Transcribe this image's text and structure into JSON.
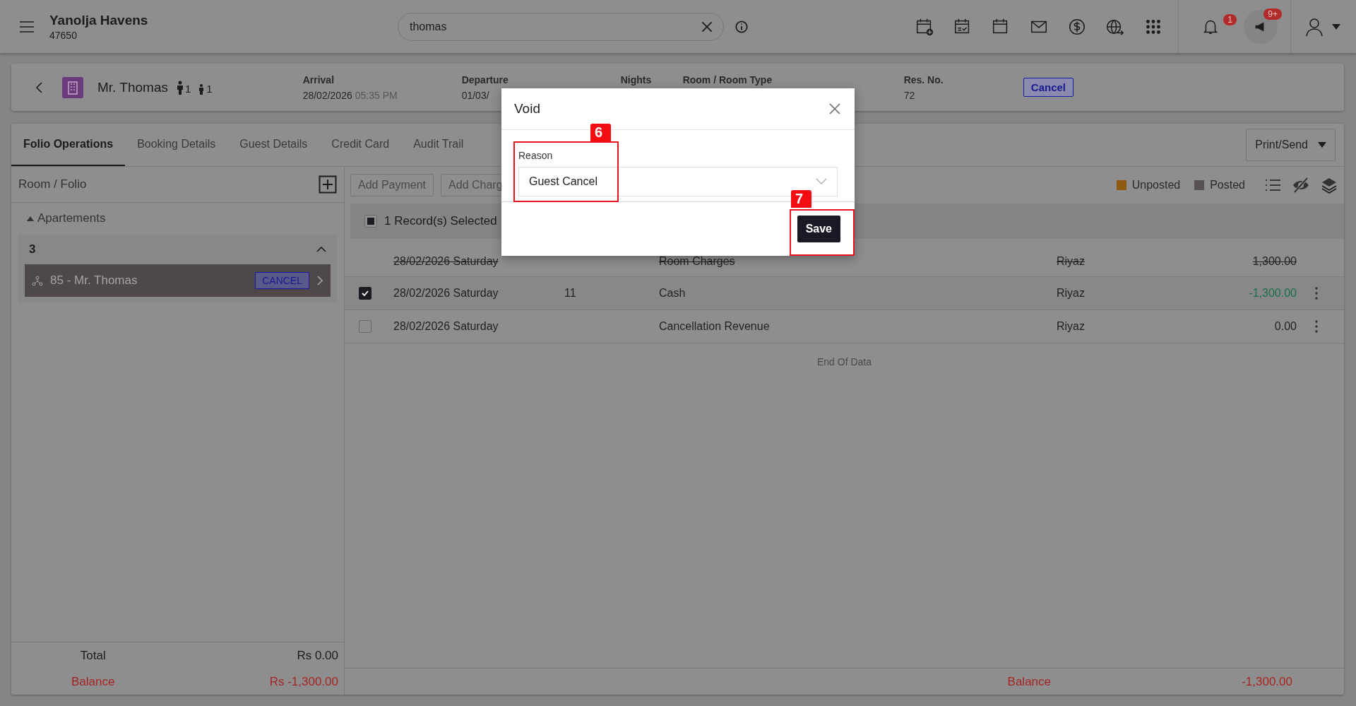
{
  "app": {
    "name": "Yanolja Havens",
    "code": "47650"
  },
  "search": {
    "value": "thomas"
  },
  "notifications": {
    "count": "1"
  },
  "announcements": {
    "count": "9+"
  },
  "reservation": {
    "guest": "Mr. Thomas",
    "adults": "1",
    "children": "1",
    "status": "Cancel",
    "fields": [
      {
        "label": "Arrival",
        "value": "28/02/2026",
        "time": "05:35 PM"
      },
      {
        "label": "Departure",
        "value": "01/03/"
      },
      {
        "label": "Nights"
      },
      {
        "label": "Room / Room Type"
      },
      {
        "label": "Res. No.",
        "value": "72"
      }
    ]
  },
  "tabs": [
    {
      "label": "Folio Operations",
      "selected": true
    },
    {
      "label": "Booking Details",
      "selected": false
    },
    {
      "label": "Guest Details",
      "selected": false
    },
    {
      "label": "Credit Card",
      "selected": false
    },
    {
      "label": "Audit Trail",
      "selected": false
    }
  ],
  "print_button": "Print/Send",
  "folio_panel": {
    "title": "Room / Folio",
    "group": {
      "label": "Apartements",
      "expanded": true,
      "rooms": [
        {
          "number": "3",
          "expanded": true,
          "folios": [
            {
              "label": "85 - Mr. Thomas",
              "status": "CANCEL",
              "selected": true
            }
          ]
        }
      ]
    },
    "total_label": "Total",
    "total": "Rs 0.00",
    "balance_label": "Balance",
    "balance": "Rs -1,300.00"
  },
  "toolbar": {
    "buttons": [
      "Add Payment",
      "Add Charg"
    ],
    "legend": [
      {
        "label": "Unposted",
        "color": "#8e5a12"
      },
      {
        "label": "Posted",
        "color": "#575151"
      }
    ]
  },
  "selection": {
    "label": "1 Record(s) Selected",
    "indeterminate": true
  },
  "transactions": [
    {
      "kind": "voided",
      "date": "28/02/2026 Saturday",
      "description": "Room Charges",
      "user": "Riyaz",
      "amount": "1,300.00"
    },
    {
      "kind": "payment",
      "checked": true,
      "date": "28/02/2026 Saturday",
      "number": "11",
      "description": "Cash",
      "user": "Riyaz",
      "amount": "-1,300.00"
    },
    {
      "kind": "charge",
      "checked": false,
      "date": "28/02/2026 Saturday",
      "description": "Cancellation Revenue",
      "user": "Riyaz",
      "amount": "0.00"
    }
  ],
  "end_label": "End Of Data",
  "footer": {
    "balance_label": "Balance",
    "balance": "-1,300.00"
  },
  "dialog": {
    "title": "Void",
    "field_label": "Reason",
    "value": "Guest Cancel",
    "save": "Save"
  },
  "callouts": [
    {
      "number": "6"
    },
    {
      "number": "7"
    }
  ]
}
